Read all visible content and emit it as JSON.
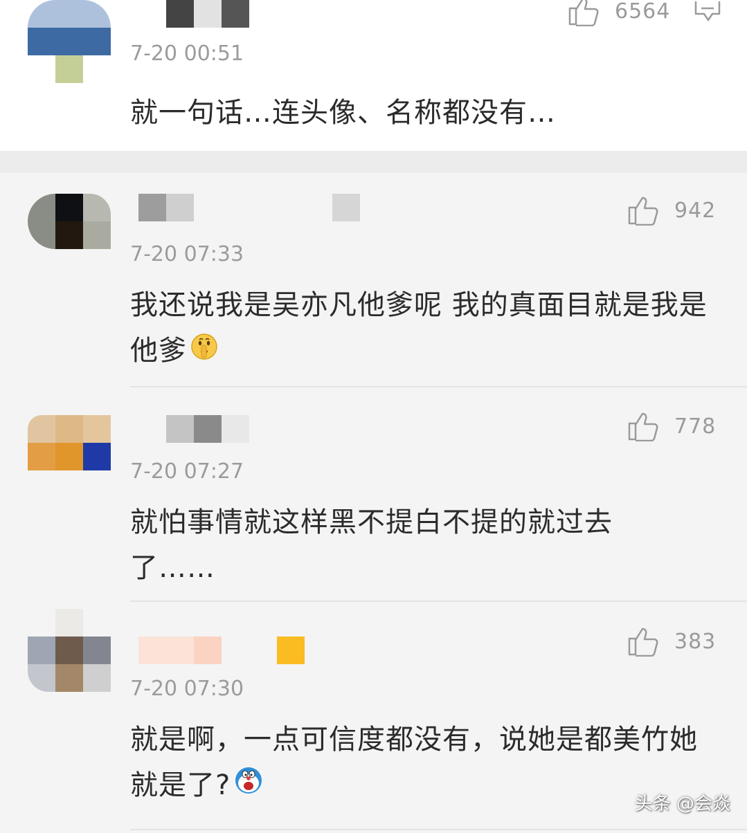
{
  "comments": [
    {
      "like_count": "6564",
      "time": "7-20 00:51",
      "text": "就一句话…连头像、名称都没有…"
    },
    {
      "like_count": "942",
      "time": "7-20 07:33",
      "text": "我还说我是吴亦凡他爹呢  我的真面目就是我是他爹",
      "emoji": "shushing-face"
    },
    {
      "like_count": "778",
      "time": "7-20 07:27",
      "text": "就怕事情就这样黑不提白不提的就过去了……"
    },
    {
      "like_count": "383",
      "time": "7-20 07:30",
      "text": "就是啊，一点可信度都没有，说她是都美竹她就是了?",
      "emoji": "doraemon-face"
    }
  ],
  "watermark": "头条 @会焱",
  "colors": {
    "text": "#2b2b2b",
    "meta": "#9b9b9b",
    "background": "#f4f4f4",
    "card": "#ffffff"
  },
  "icons": [
    "thumbs-up-icon",
    "reply-icon"
  ]
}
